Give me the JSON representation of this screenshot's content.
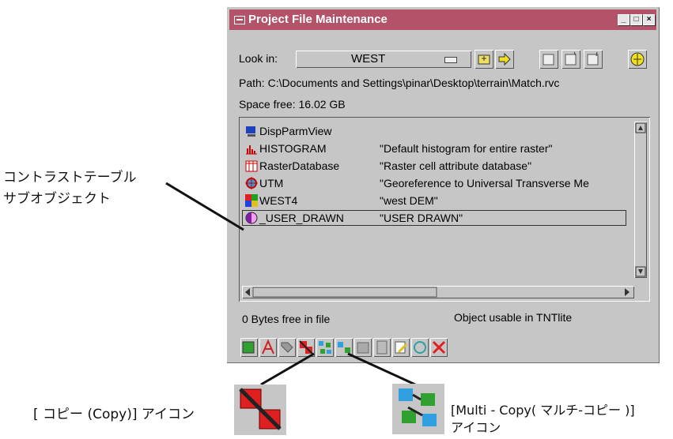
{
  "window": {
    "title": "Project File Maintenance",
    "controls": [
      "minimize-icon",
      "maximize-icon",
      "close-icon"
    ]
  },
  "toolbar_top": {
    "look_in_label": "Look in:",
    "look_in_value": "WEST",
    "path": "Path: C:\\Documents and Settings\\pinar\\Desktop\\terrain\\Match.rvc",
    "space_free": "Space free:  16.02 GB"
  },
  "objects": [
    {
      "name": "DispParmView",
      "description": "",
      "icon": "display-params-icon"
    },
    {
      "name": "HISTOGRAM",
      "description": "\"Default histogram for entire raster\"",
      "icon": "histogram-icon"
    },
    {
      "name": "RasterDatabase",
      "description": "\"Raster cell attribute database\"",
      "icon": "database-table-icon"
    },
    {
      "name": "UTM",
      "description": "\"Georeference to Universal Transverse Me",
      "icon": "georeference-icon"
    },
    {
      "name": "WEST4",
      "description": "\"west DEM\"",
      "icon": "raster-icon"
    },
    {
      "name": "_USER_DRAWN",
      "description": "\"USER DRAWN\"",
      "icon": "contrast-icon",
      "selected": true
    }
  ],
  "status": {
    "bytes_free": "0 Bytes free in file",
    "usable": "Object usable in TNTlite"
  },
  "annotations": {
    "contrast_line1": "コントラストテーブル",
    "contrast_line2": "サブオブジェクト",
    "copy_label": "[ コピー (Copy)] アイコン",
    "multicopy_line1": "[Multi - Copy( マルチ-コピー )]",
    "multicopy_line2": "アイコン"
  },
  "colors": {
    "title_bar": "#b4526a",
    "window_bg": "#c6c6c6"
  }
}
